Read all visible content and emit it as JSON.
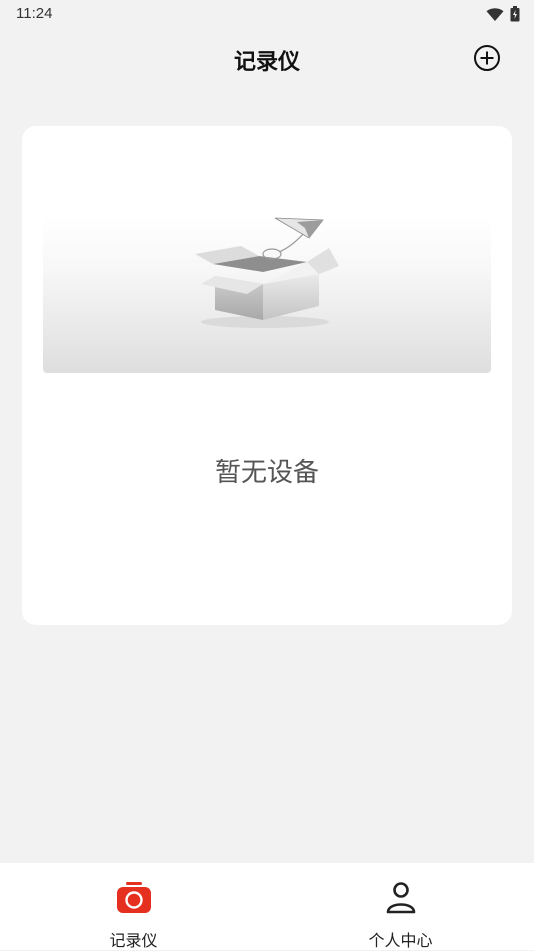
{
  "status_bar": {
    "time": "11:24",
    "icons": [
      "wifi-icon",
      "battery-icon"
    ]
  },
  "header": {
    "title": "记录仪",
    "add_icon": "add-circle-icon"
  },
  "main": {
    "empty_state": {
      "illustration": "empty-box-with-paper-plane",
      "text": "暂无设备"
    }
  },
  "bottom_nav": {
    "items": [
      {
        "label": "记录仪",
        "icon": "camera-icon",
        "active": true,
        "color": "#e52f1f"
      },
      {
        "label": "个人中心",
        "icon": "person-icon",
        "active": false,
        "color": "#222222"
      }
    ]
  }
}
